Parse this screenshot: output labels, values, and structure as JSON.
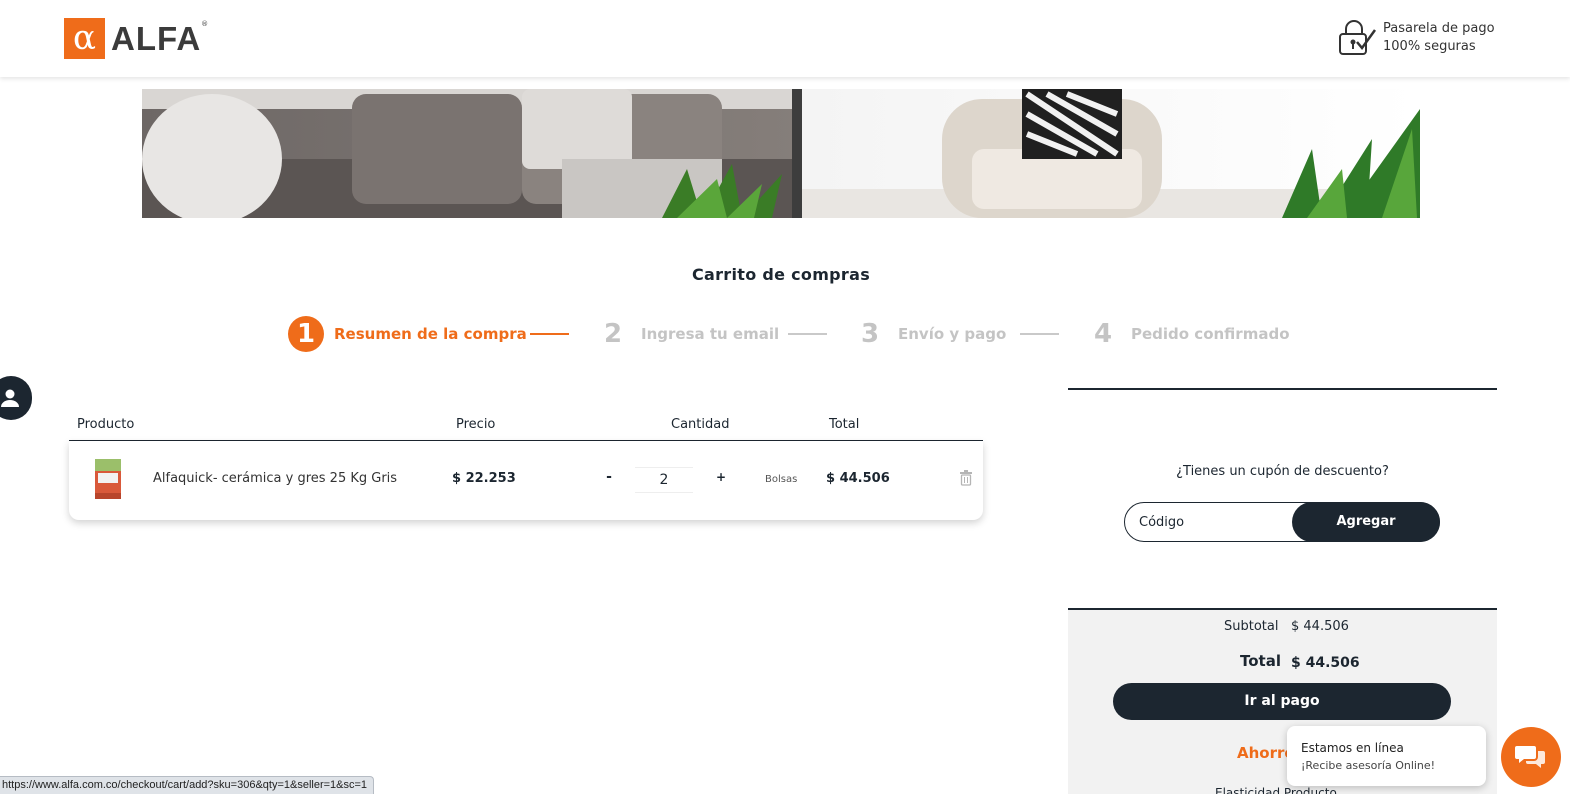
{
  "header": {
    "logo_symbol": "α",
    "logo_text": "ALFA",
    "logo_reg": "®",
    "secure_line1": "Pasarela de pago",
    "secure_line2": "100% seguras",
    "secure_icon": "padlock-check-icon"
  },
  "page": {
    "title": "Carrito de compras"
  },
  "steps": [
    {
      "number": "1",
      "label": "Resumen de la compra",
      "active": true
    },
    {
      "number": "2",
      "label": "Ingresa tu email",
      "active": false
    },
    {
      "number": "3",
      "label": "Envío y pago",
      "active": false
    },
    {
      "number": "4",
      "label": "Pedido confirmado",
      "active": false
    }
  ],
  "cart": {
    "headers": {
      "product": "Producto",
      "price": "Precio",
      "quantity": "Cantidad",
      "total": "Total"
    },
    "items": [
      {
        "name": "Alfaquick- cerámica y gres 25 Kg Gris",
        "price": "$ 22.253",
        "minus": "-",
        "quantity": "2",
        "plus": "+",
        "unit": "Bolsas",
        "total": "$ 44.506"
      }
    ]
  },
  "coupon": {
    "question": "¿Tienes un cupón de descuento?",
    "placeholder": "Código",
    "button": "Agregar"
  },
  "summary": {
    "subtotal_label": "Subtotal",
    "subtotal_value": "$ 44.506",
    "total_label": "Total",
    "total_value": "$ 44.506",
    "pay_button": "Ir al pago",
    "savings_label": "Ahorro",
    "cut_text": "Elasticidad Producto"
  },
  "chat": {
    "title": "Estamos en línea",
    "subtitle": "¡Recibe asesoría Online!"
  },
  "status_bar": {
    "url": "https://www.alfa.com.co/checkout/cart/add?sku=306&qty=1&seller=1&sc=1"
  },
  "colors": {
    "accent": "#ef6c1a",
    "dark": "#1c2630",
    "inactive": "#c4c4c4"
  }
}
